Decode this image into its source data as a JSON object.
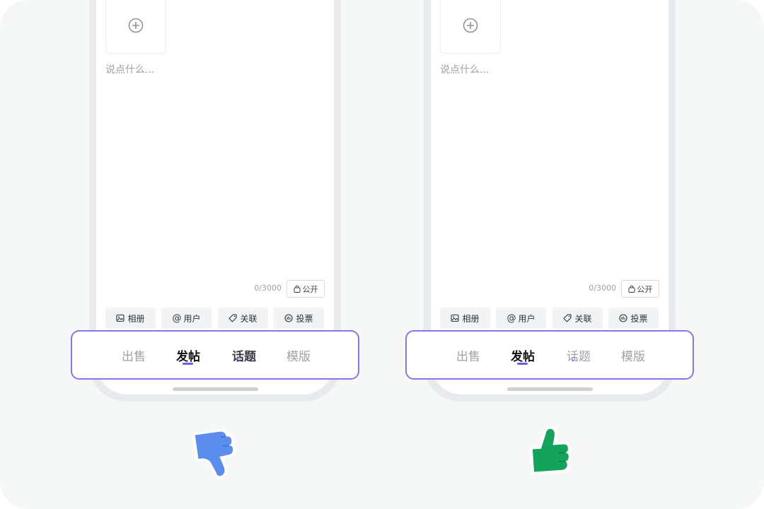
{
  "comparison": [
    {
      "verdict": "thumbs-down",
      "placeholder": "说点什么...",
      "char_counter": "0/3000",
      "visibility_label": "公开",
      "tools": [
        {
          "label": "相册",
          "icon": "image-icon"
        },
        {
          "label": "用户",
          "icon": "at-icon"
        },
        {
          "label": "关联",
          "icon": "tag-icon"
        },
        {
          "label": "投票",
          "icon": "poll-icon"
        }
      ],
      "tabs": [
        {
          "label": "出售",
          "state": "inactive"
        },
        {
          "label": "发帖",
          "state": "active"
        },
        {
          "label": "话题",
          "state": "bold-inactive"
        },
        {
          "label": "模版",
          "state": "inactive"
        }
      ],
      "thumb_color": "#5b8dee"
    },
    {
      "verdict": "thumbs-up",
      "placeholder": "说点什么...",
      "char_counter": "0/3000",
      "visibility_label": "公开",
      "tools": [
        {
          "label": "相册",
          "icon": "image-icon"
        },
        {
          "label": "用户",
          "icon": "at-icon"
        },
        {
          "label": "关联",
          "icon": "tag-icon"
        },
        {
          "label": "投票",
          "icon": "poll-icon"
        }
      ],
      "tabs": [
        {
          "label": "出售",
          "state": "inactive"
        },
        {
          "label": "发帖",
          "state": "active"
        },
        {
          "label": "话题",
          "state": "inactive"
        },
        {
          "label": "模版",
          "state": "inactive"
        }
      ],
      "thumb_color": "#14a35a"
    }
  ],
  "colors": {
    "tab_highlight_border": "#8b73f3",
    "active_underline": "#6c5ce7",
    "background": "#f6f7f7"
  }
}
